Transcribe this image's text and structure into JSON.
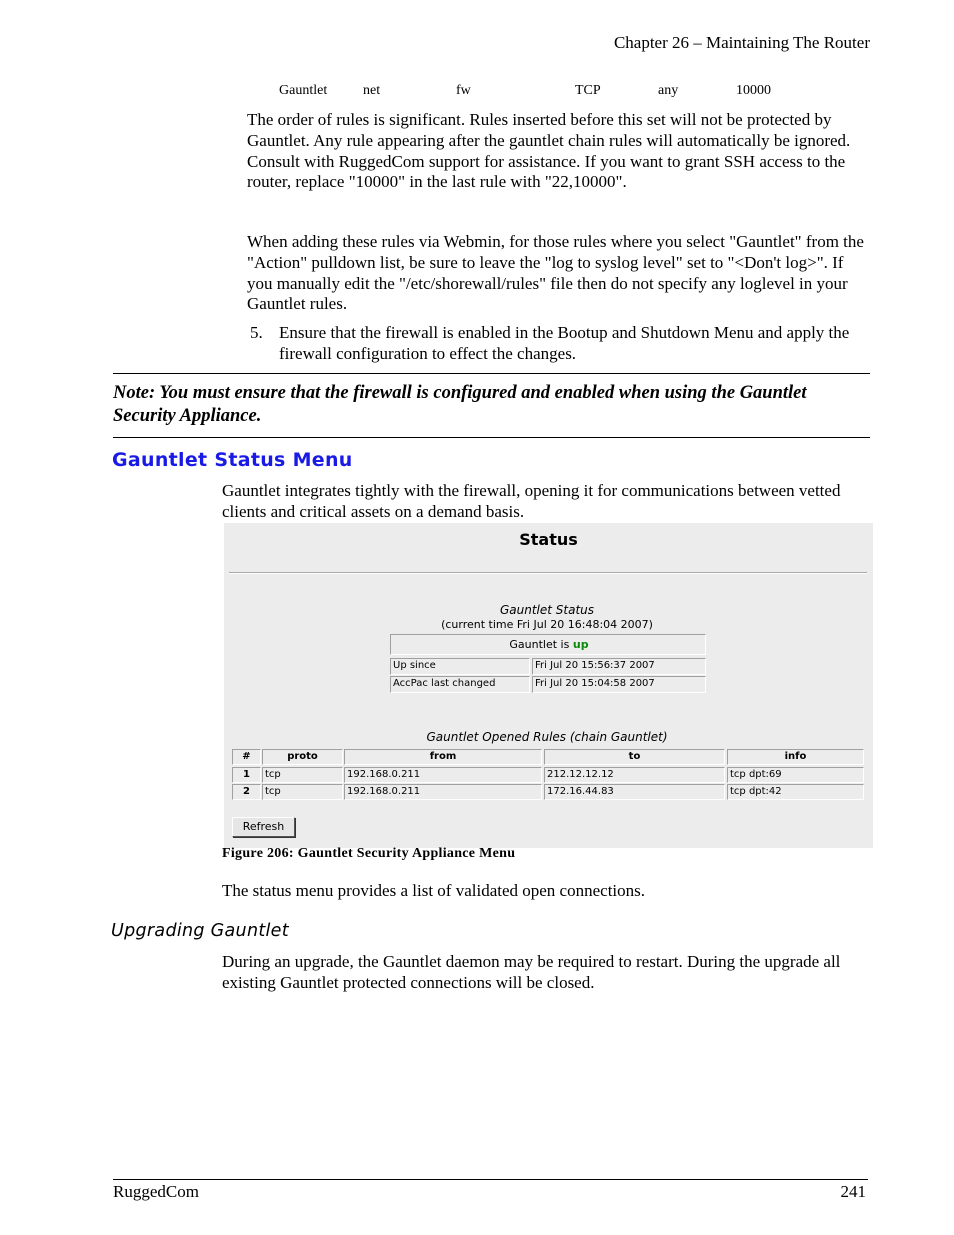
{
  "header": {
    "chapter": "Chapter 26 – Maintaining The Router"
  },
  "rule_row": [
    "Gauntlet",
    "net",
    "fw",
    "TCP",
    "any",
    "10000"
  ],
  "paragraphs": {
    "rules_order": "The order of rules is significant.  Rules inserted before this set will not be protected by Gauntlet.  Any rule appearing after the gauntlet chain rules will automatically be ignored.  Consult with RuggedCom support for assistance.  If you want to grant SSH access to the router, replace \"10000\" in the last rule with \"22,10000\".",
    "webmin": "When adding these rules via Webmin, for those rules where you select \"Gauntlet\" from the \"Action\" pulldown list, be sure to leave the \"log to syslog level\" set to \"<Don't log>\".  If you manually edit the \"/etc/shorewall/rules\" file then do not specify any loglevel in your Gauntlet rules.",
    "gauntlet_intro": "Gauntlet integrates tightly with the firewall, opening it for communications between vetted clients and critical assets on a demand basis.",
    "status_desc": "The status menu provides a list of validated open connections.",
    "upgrade_desc": "During an upgrade, the Gauntlet daemon may be required to restart.  During the upgrade all existing Gauntlet protected connections will be closed."
  },
  "list_item": {
    "number": "5.",
    "text": "Ensure that the firewall is enabled in the Bootup and Shutdown Menu and apply the firewall configuration to effect the changes."
  },
  "note": "Note:  You must ensure that the firewall is configured and enabled when using the Gauntlet Security Appliance.",
  "section_title": "Gauntlet Status Menu",
  "figure": {
    "title": "Status",
    "gauntlet_status_title": "Gauntlet Status",
    "current_time": "(current time Fri Jul 20 16:48:04 2007)",
    "status_prefix": "Gauntlet is",
    "status_value": "up",
    "status_color": "#0a8a0a",
    "status_rows": [
      {
        "label": "Up since",
        "value": "Fri Jul 20 15:56:37 2007"
      },
      {
        "label": "AccPac last changed",
        "value": "Fri Jul 20 15:04:58 2007"
      }
    ],
    "rules_title": "Gauntlet Opened Rules (chain Gauntlet)",
    "rules_columns": [
      "#",
      "proto",
      "from",
      "to",
      "info"
    ],
    "rules": [
      {
        "num": "1",
        "proto": "tcp",
        "from": "192.168.0.211",
        "to": "212.12.12.12",
        "info": "tcp dpt:69"
      },
      {
        "num": "2",
        "proto": "tcp",
        "from": "192.168.0.211",
        "to": "172.16.44.83",
        "info": "tcp dpt:42"
      }
    ],
    "refresh_label": "Refresh"
  },
  "caption": "Figure 206:  Gauntlet Security Appliance Menu",
  "subsection_title": "Upgrading Gauntlet",
  "footer": {
    "left": "RuggedCom",
    "page": "241"
  }
}
